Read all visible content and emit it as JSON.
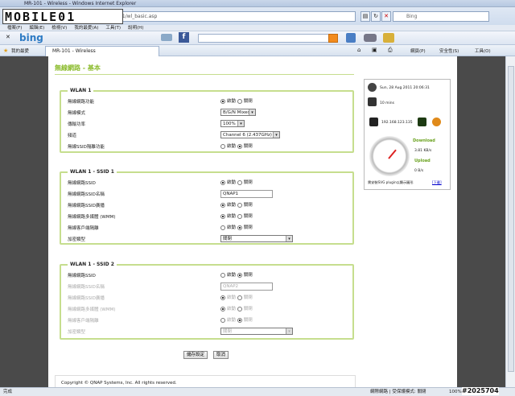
{
  "window": {
    "title": "MR-101 - Wireless - Windows Internet Explorer"
  },
  "address": {
    "url": "http://192.168.1.1/wl_basic.asp",
    "search_placeholder": "Bing"
  },
  "watermark_logo": "MOBILE01",
  "menu": [
    "檔案(F)",
    "編輯(E)",
    "檢視(V)",
    "我的最愛(A)",
    "工具(T)",
    "說明(H)"
  ],
  "bingbar": {
    "label": "bing"
  },
  "favbar": {
    "favorites": "我的最愛",
    "tab": "MR-101 - Wireless",
    "tools": [
      "網頁(P)",
      "安全性(S)",
      "工具(O)"
    ]
  },
  "page": {
    "heading": "無線網路 - 基本",
    "wlan1": {
      "legend": "WLAN 1",
      "rows": [
        {
          "label": "無線網路功能",
          "on": "啟動",
          "off": "關閉"
        },
        {
          "label": "無線模式",
          "value": "B/G/N Mixed"
        },
        {
          "label": "傳輸功率",
          "value": "100%"
        },
        {
          "label": "頻道",
          "value": "Channel 6 (2.437GHz)"
        },
        {
          "label": "無線SSID隔離功能",
          "on": "啟動",
          "off": "關閉"
        }
      ]
    },
    "ssid1": {
      "legend": "WLAN 1 - SSID 1",
      "rows": [
        {
          "label": "無線網路SSID",
          "on": "啟動",
          "off": "關閉"
        },
        {
          "label": "無線網路SSID名稱",
          "value": "QNAP1"
        },
        {
          "label": "無線網路SSID廣播",
          "on": "啟動",
          "off": "關閉"
        },
        {
          "label": "無線網路多媒體 (WMM)",
          "on": "啟動",
          "off": "關閉"
        },
        {
          "label": "無線客戶端隔離",
          "on": "啟動",
          "off": "關閉"
        },
        {
          "label": "加密類型",
          "value": "關閉"
        }
      ]
    },
    "ssid2": {
      "legend": "WLAN 1 - SSID 2",
      "rows": [
        {
          "label": "無線網路SSID",
          "on": "啟動",
          "off": "關閉"
        },
        {
          "label": "無線網路SSID名稱",
          "value": "QNAP2"
        },
        {
          "label": "無線網路SSID廣播",
          "on": "啟動",
          "off": "關閉"
        },
        {
          "label": "無線網路多媒體 (WMM)",
          "on": "啟動",
          "off": "關閉"
        },
        {
          "label": "無線客戶端隔離",
          "on": "啟動",
          "off": "關閉"
        },
        {
          "label": "加密類型",
          "value": "關閉"
        }
      ]
    },
    "save": "儲存設定",
    "cancel": "取消",
    "footer": "Copyright © QNAP Systems, Inc. All rights reserved."
  },
  "panel": {
    "datetime": "Sun, 28 Aug 2011 20:06:31",
    "uptime": "10 mins",
    "ip": "192.168.123.135",
    "download_label": "Download",
    "download_value": "3.81 KB/s",
    "upload_label": "Upload",
    "upload_value": "0 B/s",
    "note": "需安裝SVG plugin以顯示圖形",
    "note_link": "[下載]"
  },
  "status": {
    "left": "完成",
    "zone": "網際網路 | 受保護模式: 關閉",
    "zoom": "100%"
  },
  "watermark": "#2025704"
}
